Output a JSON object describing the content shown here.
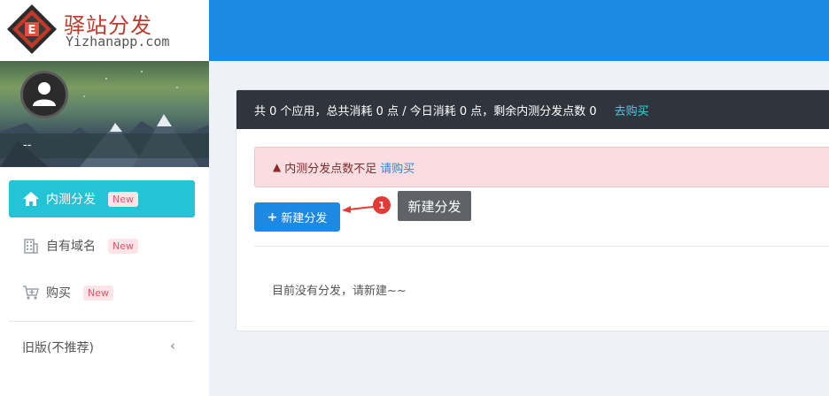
{
  "brand": {
    "title": "驿站分发",
    "subtitle": "Yizhanapp.com",
    "color": "#c0392b"
  },
  "colors": {
    "header": "#1e88e5",
    "active_nav": "#24c3d6",
    "panel_head": "#30353d",
    "alert_bg": "#f9dde0",
    "primary_button": "#1e88e5"
  },
  "user": {
    "name": "--",
    "avatar_icon": "user-avatar-icon"
  },
  "sidebar": {
    "items": [
      {
        "label": "内测分发",
        "badge": "New",
        "icon": "home-icon",
        "active": true
      },
      {
        "label": "自有域名",
        "badge": "New",
        "icon": "building-icon",
        "active": false
      },
      {
        "label": "购买",
        "badge": "New",
        "icon": "cart-icon",
        "active": false
      }
    ],
    "legacy": {
      "label": "旧版(不推荐)",
      "icon": "chevron-left-icon"
    }
  },
  "panel": {
    "summary": "共 0 个应用，总共消耗 0 点 / 今日消耗 0 点，剩余内测分发点数 0",
    "buy_link": "去购买",
    "alert_text": "内测分发点数不足",
    "alert_link": "请购买",
    "new_button": "新建分发",
    "empty_text": "目前没有分发，请新建~~"
  },
  "callout": {
    "number": "1",
    "label": "新建分发"
  }
}
